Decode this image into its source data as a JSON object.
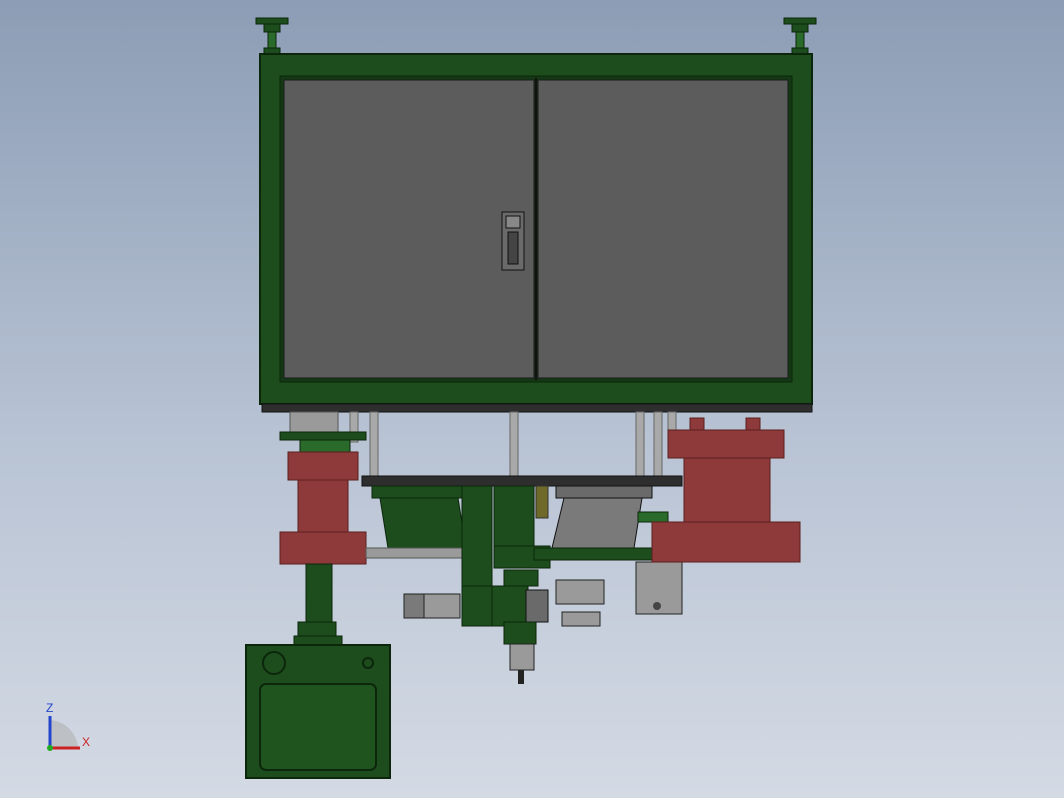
{
  "view": {
    "title": "",
    "background_top": "#8c9db5",
    "background_bottom": "#d4dae4"
  },
  "colors": {
    "frame_green": "#1d4d1d",
    "frame_dark": "#0c260c",
    "panel_gray": "#5c5c5c",
    "cylinder_red": "#8e3a3a",
    "cylinder_dark": "#5a1f1f",
    "steel_gray": "#9a9a9a",
    "rod_gray": "#a9a9a9"
  },
  "triad": {
    "z_label": "Z",
    "x_label": "X",
    "z_color": "#2244cc",
    "x_color": "#cc2222",
    "y_color": "#22aa22"
  },
  "components": {
    "cabinet": "electrical-cabinet",
    "door_handle": "door-handle-icon",
    "leveling_feet": "leveling-foot-icon",
    "red_cylinders": "cylinder-icon",
    "control_box": "control-box",
    "motor_units": "motor-icon"
  }
}
